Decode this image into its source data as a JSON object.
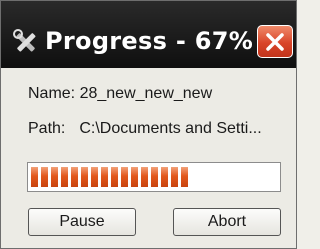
{
  "window": {
    "title": "Progress - 67%",
    "close_icon": "close-icon",
    "app_icon": "tools-icon"
  },
  "info": {
    "name_label": "Name:",
    "name_value": "28_new_new_new",
    "path_label": "Path:",
    "path_value": "C:\\Documents and Setti..."
  },
  "progress": {
    "value_percent": 67
  },
  "buttons": {
    "pause_label": "Pause",
    "abort_label": "Abort"
  },
  "colors": {
    "titlebar": "#1a1a1a",
    "close_button": "#d9452a",
    "progress_fill": "#e2581c"
  }
}
